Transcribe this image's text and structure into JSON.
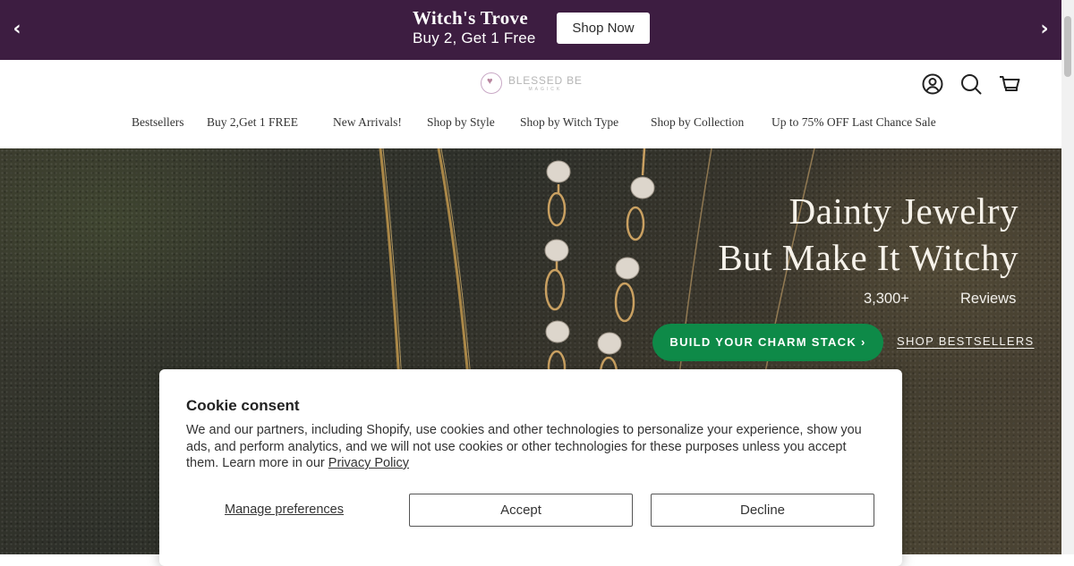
{
  "announcement": {
    "title": "Witch's Trove",
    "subtitle": "Buy 2, Get 1 Free",
    "button_label": "Shop Now",
    "prev_arrow": "‹",
    "next_arrow": "›",
    "background_color": "#3d1d41"
  },
  "header": {
    "logo": {
      "line1": "BLESSED BE",
      "line2": "MAGICK"
    },
    "icons": [
      "account-icon",
      "search-icon",
      "cart-icon"
    ],
    "nav": [
      {
        "label": "Bestsellers"
      },
      {
        "label": "Buy 2,Get 1 FREE"
      },
      {
        "label": "New Arrivals!"
      },
      {
        "label": "Shop by Style"
      },
      {
        "label": "Shop by Witch Type"
      },
      {
        "label": "Shop by Collection"
      },
      {
        "label": "Up to 75% OFF Last Chance Sale"
      }
    ]
  },
  "hero": {
    "headline_line1": "Dainty Jewelry",
    "headline_line2": "But Make It Witchy",
    "reviews_count": "3,300+",
    "reviews_label": "Reviews",
    "cta_label": "BUILD YOUR CHARM STACK ›",
    "secondary_link": "SHOP BESTSELLERS",
    "cta_color": "#0e8a48"
  },
  "cookie": {
    "title": "Cookie consent",
    "body": "We and our partners, including Shopify, use cookies and other technologies to personalize your experience, show you ads, and perform analytics, and we will not use cookies or other technologies for these purposes unless you accept them. Learn more in our ",
    "privacy_link": "Privacy Policy",
    "manage_label": "Manage preferences",
    "accept_label": "Accept",
    "decline_label": "Decline"
  }
}
